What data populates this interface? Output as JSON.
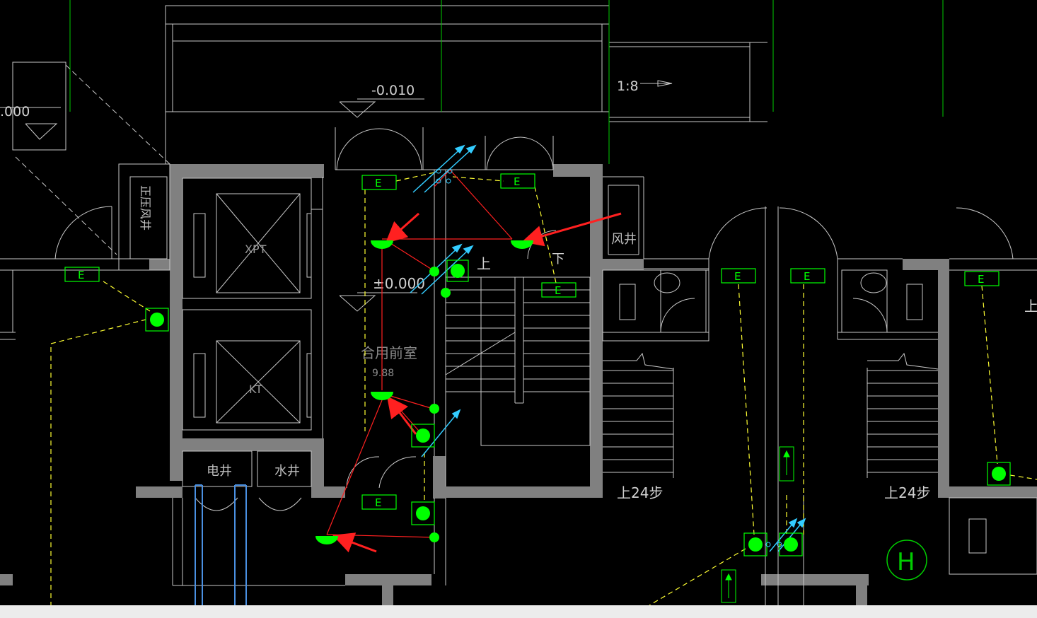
{
  "drawing": {
    "elevations": {
      "upper": "-0.010",
      "left_cut": ".000",
      "main": "±0.000"
    },
    "slope_label": "1:8",
    "room_labels": {
      "lift_upper": "XPT",
      "lift_lower": "KT",
      "fire_shaft_left": "正压风井",
      "vent_shaft": "风井",
      "anteroom": "合用前室",
      "anteroom_area": "9.88",
      "elec_shaft": "电井",
      "water_shaft": "水井"
    },
    "stair_labels": {
      "up": "上",
      "down": "下",
      "up_right_cut": "上",
      "steps_mid": "上24步",
      "steps_right": "上24步"
    },
    "exit_sign": "E",
    "hydrant": "H"
  },
  "colors": {
    "background": "#000000",
    "wall": "#808080",
    "line": "#c8c8c8",
    "green_line": "#00cc00",
    "yellow_dash": "#ffff33",
    "red": "#ff2020",
    "cyan": "#33ccff",
    "device": "#00ff00"
  }
}
